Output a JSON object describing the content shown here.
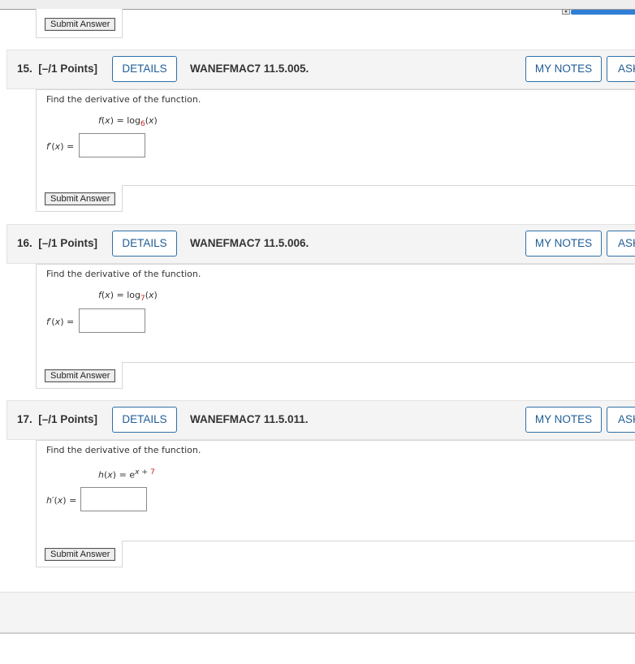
{
  "submit_label": "Submit Answer",
  "questions": [
    {
      "number": "15.",
      "points": "[–/1 Points]",
      "details_label": "DETAILS",
      "code": "WANEFMAC7 11.5.005.",
      "notes_label": "MY NOTES",
      "ask_label": "ASK YOUR TEACHER",
      "prompt": "Find the derivative of the function.",
      "func_name": "f",
      "base": "6",
      "answer_label_fn": "f",
      "answer_value": ""
    },
    {
      "number": "16.",
      "points": "[–/1 Points]",
      "details_label": "DETAILS",
      "code": "WANEFMAC7 11.5.006.",
      "notes_label": "MY NOTES",
      "ask_label": "ASK YOUR TEACHER",
      "prompt": "Find the derivative of the function.",
      "func_name": "f",
      "base": "7",
      "answer_label_fn": "f",
      "answer_value": ""
    },
    {
      "number": "17.",
      "points": "[–/1 Points]",
      "details_label": "DETAILS",
      "code": "WANEFMAC7 11.5.011.",
      "notes_label": "MY NOTES",
      "ask_label": "ASK YOUR TEACHER",
      "prompt": "Find the derivative of the function.",
      "func_name": "h",
      "exponent_const": "7",
      "answer_label_fn": "h",
      "answer_value": ""
    }
  ],
  "colors": {
    "accent": "#1f5d96",
    "red_value": "#cc2222",
    "header_bg": "#f4f4f4",
    "progress": "#2f7fd6"
  }
}
